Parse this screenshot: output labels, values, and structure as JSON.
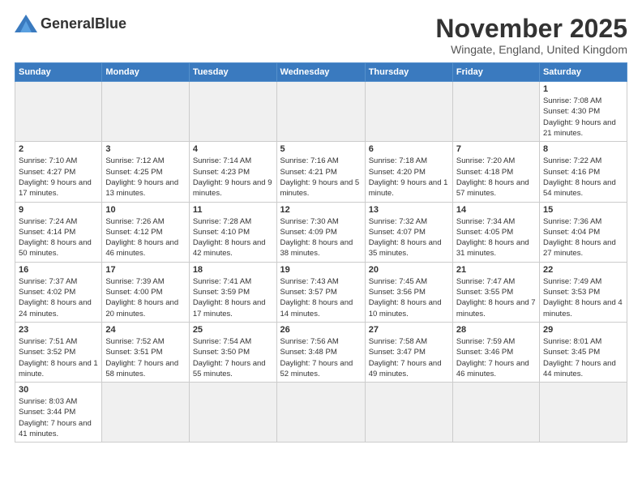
{
  "logo": {
    "text_normal": "General",
    "text_bold": "Blue"
  },
  "title": "November 2025",
  "subtitle": "Wingate, England, United Kingdom",
  "headers": [
    "Sunday",
    "Monday",
    "Tuesday",
    "Wednesday",
    "Thursday",
    "Friday",
    "Saturday"
  ],
  "weeks": [
    [
      {
        "day": "",
        "info": ""
      },
      {
        "day": "",
        "info": ""
      },
      {
        "day": "",
        "info": ""
      },
      {
        "day": "",
        "info": ""
      },
      {
        "day": "",
        "info": ""
      },
      {
        "day": "",
        "info": ""
      },
      {
        "day": "1",
        "info": "Sunrise: 7:08 AM\nSunset: 4:30 PM\nDaylight: 9 hours and 21 minutes."
      }
    ],
    [
      {
        "day": "2",
        "info": "Sunrise: 7:10 AM\nSunset: 4:27 PM\nDaylight: 9 hours and 17 minutes."
      },
      {
        "day": "3",
        "info": "Sunrise: 7:12 AM\nSunset: 4:25 PM\nDaylight: 9 hours and 13 minutes."
      },
      {
        "day": "4",
        "info": "Sunrise: 7:14 AM\nSunset: 4:23 PM\nDaylight: 9 hours and 9 minutes."
      },
      {
        "day": "5",
        "info": "Sunrise: 7:16 AM\nSunset: 4:21 PM\nDaylight: 9 hours and 5 minutes."
      },
      {
        "day": "6",
        "info": "Sunrise: 7:18 AM\nSunset: 4:20 PM\nDaylight: 9 hours and 1 minute."
      },
      {
        "day": "7",
        "info": "Sunrise: 7:20 AM\nSunset: 4:18 PM\nDaylight: 8 hours and 57 minutes."
      },
      {
        "day": "8",
        "info": "Sunrise: 7:22 AM\nSunset: 4:16 PM\nDaylight: 8 hours and 54 minutes."
      }
    ],
    [
      {
        "day": "9",
        "info": "Sunrise: 7:24 AM\nSunset: 4:14 PM\nDaylight: 8 hours and 50 minutes."
      },
      {
        "day": "10",
        "info": "Sunrise: 7:26 AM\nSunset: 4:12 PM\nDaylight: 8 hours and 46 minutes."
      },
      {
        "day": "11",
        "info": "Sunrise: 7:28 AM\nSunset: 4:10 PM\nDaylight: 8 hours and 42 minutes."
      },
      {
        "day": "12",
        "info": "Sunrise: 7:30 AM\nSunset: 4:09 PM\nDaylight: 8 hours and 38 minutes."
      },
      {
        "day": "13",
        "info": "Sunrise: 7:32 AM\nSunset: 4:07 PM\nDaylight: 8 hours and 35 minutes."
      },
      {
        "day": "14",
        "info": "Sunrise: 7:34 AM\nSunset: 4:05 PM\nDaylight: 8 hours and 31 minutes."
      },
      {
        "day": "15",
        "info": "Sunrise: 7:36 AM\nSunset: 4:04 PM\nDaylight: 8 hours and 27 minutes."
      }
    ],
    [
      {
        "day": "16",
        "info": "Sunrise: 7:37 AM\nSunset: 4:02 PM\nDaylight: 8 hours and 24 minutes."
      },
      {
        "day": "17",
        "info": "Sunrise: 7:39 AM\nSunset: 4:00 PM\nDaylight: 8 hours and 20 minutes."
      },
      {
        "day": "18",
        "info": "Sunrise: 7:41 AM\nSunset: 3:59 PM\nDaylight: 8 hours and 17 minutes."
      },
      {
        "day": "19",
        "info": "Sunrise: 7:43 AM\nSunset: 3:57 PM\nDaylight: 8 hours and 14 minutes."
      },
      {
        "day": "20",
        "info": "Sunrise: 7:45 AM\nSunset: 3:56 PM\nDaylight: 8 hours and 10 minutes."
      },
      {
        "day": "21",
        "info": "Sunrise: 7:47 AM\nSunset: 3:55 PM\nDaylight: 8 hours and 7 minutes."
      },
      {
        "day": "22",
        "info": "Sunrise: 7:49 AM\nSunset: 3:53 PM\nDaylight: 8 hours and 4 minutes."
      }
    ],
    [
      {
        "day": "23",
        "info": "Sunrise: 7:51 AM\nSunset: 3:52 PM\nDaylight: 8 hours and 1 minute."
      },
      {
        "day": "24",
        "info": "Sunrise: 7:52 AM\nSunset: 3:51 PM\nDaylight: 7 hours and 58 minutes."
      },
      {
        "day": "25",
        "info": "Sunrise: 7:54 AM\nSunset: 3:50 PM\nDaylight: 7 hours and 55 minutes."
      },
      {
        "day": "26",
        "info": "Sunrise: 7:56 AM\nSunset: 3:48 PM\nDaylight: 7 hours and 52 minutes."
      },
      {
        "day": "27",
        "info": "Sunrise: 7:58 AM\nSunset: 3:47 PM\nDaylight: 7 hours and 49 minutes."
      },
      {
        "day": "28",
        "info": "Sunrise: 7:59 AM\nSunset: 3:46 PM\nDaylight: 7 hours and 46 minutes."
      },
      {
        "day": "29",
        "info": "Sunrise: 8:01 AM\nSunset: 3:45 PM\nDaylight: 7 hours and 44 minutes."
      }
    ],
    [
      {
        "day": "30",
        "info": "Sunrise: 8:03 AM\nSunset: 3:44 PM\nDaylight: 7 hours and 41 minutes."
      },
      {
        "day": "",
        "info": ""
      },
      {
        "day": "",
        "info": ""
      },
      {
        "day": "",
        "info": ""
      },
      {
        "day": "",
        "info": ""
      },
      {
        "day": "",
        "info": ""
      },
      {
        "day": "",
        "info": ""
      }
    ]
  ]
}
